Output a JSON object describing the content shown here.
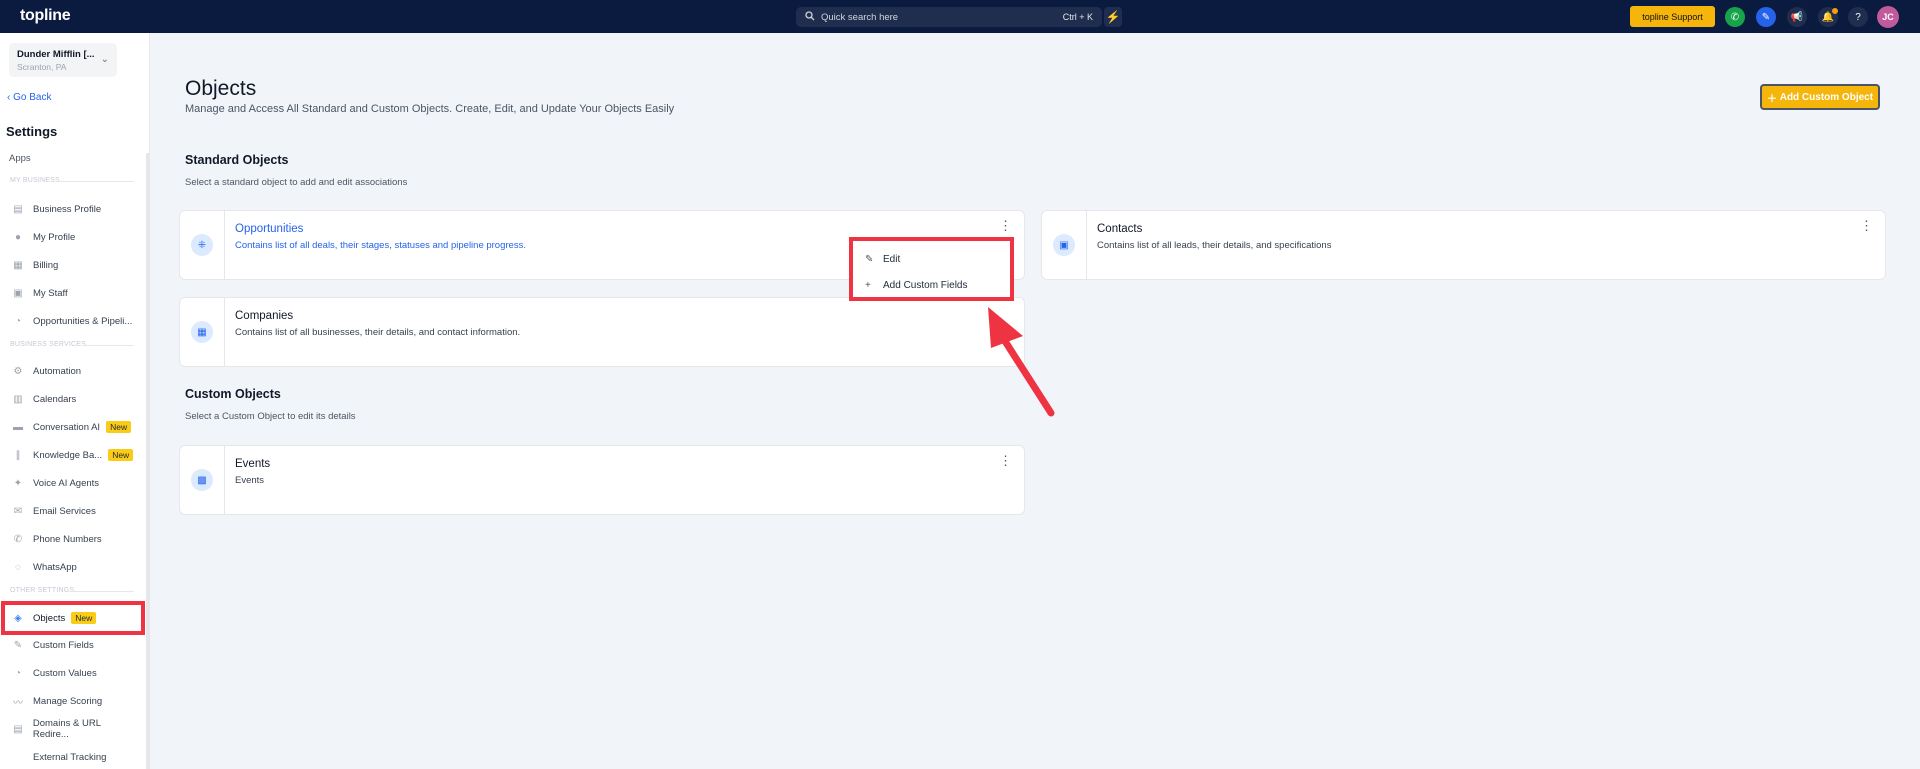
{
  "topbar": {
    "logo": "topline",
    "search_placeholder": "Quick search here",
    "search_shortcut": "Ctrl + K",
    "support_label": "topline Support",
    "avatar_initials": "JC"
  },
  "sidebar": {
    "location_name": "Dunder Mifflin [...",
    "location_sub": "Scranton, PA",
    "go_back": "Go Back",
    "settings_title": "Settings",
    "apps": "Apps",
    "section_my_business": "MY BUSINESS",
    "section_business_services": "BUSINESS SERVICES",
    "section_other_settings": "OTHER SETTINGS",
    "items": [
      {
        "label": "Business Profile",
        "icon": "store-icon"
      },
      {
        "label": "My Profile",
        "icon": "user-icon"
      },
      {
        "label": "Billing",
        "icon": "grid-icon"
      },
      {
        "label": "My Staff",
        "icon": "staff-icon"
      },
      {
        "label": "Opportunities & Pipeli...",
        "icon": "pipeline-icon"
      },
      {
        "label": "Automation",
        "icon": "automation-icon"
      },
      {
        "label": "Calendars",
        "icon": "calendar-icon"
      },
      {
        "label": "Conversation AI",
        "icon": "chat-icon",
        "badge": "New"
      },
      {
        "label": "Knowledge Ba...",
        "icon": "book-icon",
        "badge": "New"
      },
      {
        "label": "Voice AI Agents",
        "icon": "voice-icon"
      },
      {
        "label": "Email Services",
        "icon": "email-icon"
      },
      {
        "label": "Phone Numbers",
        "icon": "phone-icon"
      },
      {
        "label": "WhatsApp",
        "icon": "whatsapp-icon"
      },
      {
        "label": "Objects",
        "icon": "objects-icon",
        "badge": "New"
      },
      {
        "label": "Custom Fields",
        "icon": "edit-field-icon"
      },
      {
        "label": "Custom Values",
        "icon": "values-icon"
      },
      {
        "label": "Manage Scoring",
        "icon": "chart-line-icon"
      },
      {
        "label": "Domains & URL Redire...",
        "icon": "domain-icon"
      },
      {
        "label": "External Tracking",
        "icon": "tracking-icon"
      }
    ]
  },
  "main": {
    "title": "Objects",
    "subtitle": "Manage and Access All Standard and Custom Objects. Create, Edit, and Update Your Objects Easily",
    "add_button": "Add Custom Object",
    "standard_title": "Standard Objects",
    "standard_sub": "Select a standard object to add and edit associations",
    "custom_title": "Custom Objects",
    "custom_sub": "Select a Custom Object to edit its details",
    "cards": [
      {
        "title": "Opportunities",
        "desc": "Contains list of all deals, their stages, statuses and pipeline progress."
      },
      {
        "title": "Contacts",
        "desc": "Contains list of all leads, their details, and specifications"
      },
      {
        "title": "Companies",
        "desc": "Contains list of all businesses, their details, and contact information."
      },
      {
        "title": "Events",
        "desc": "Events"
      }
    ],
    "menu": {
      "edit": "Edit",
      "add_fields": "Add Custom Fields"
    }
  },
  "colors": {
    "topbar": "#0b1b3f",
    "accent": "#f5b50b",
    "link": "#2563eb",
    "highlight": "#ee3342"
  }
}
